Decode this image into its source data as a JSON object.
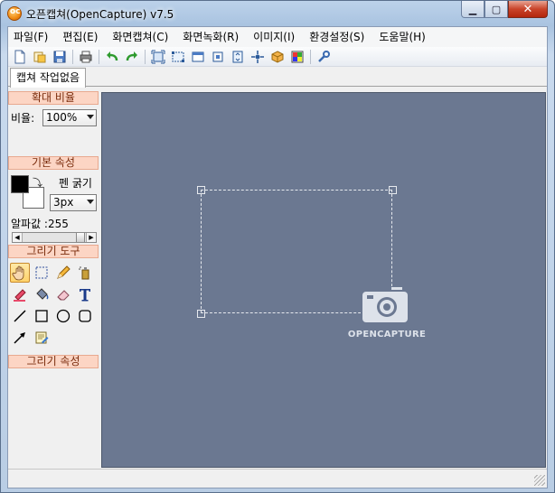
{
  "window": {
    "title": "오픈캡쳐(OpenCapture) v7.5"
  },
  "menu": {
    "items": [
      {
        "label": "파일(F)"
      },
      {
        "label": "편집(E)"
      },
      {
        "label": "화면캡쳐(C)"
      },
      {
        "label": "화면녹화(R)"
      },
      {
        "label": "이미지(I)"
      },
      {
        "label": "환경설정(S)"
      },
      {
        "label": "도움말(H)"
      }
    ]
  },
  "toolbar": {
    "icons": [
      "new-icon",
      "open-icon",
      "save-icon",
      "print-icon",
      "undo-icon",
      "redo-icon",
      "capture-fullscreen-icon",
      "capture-region-icon",
      "capture-window-icon",
      "capture-element-icon",
      "capture-scroll-icon",
      "capture-fixed-icon",
      "capture-3d-icon",
      "color-picker-icon",
      "settings-wrench-icon"
    ]
  },
  "tabs": [
    {
      "label": "캡쳐 작업없음"
    }
  ],
  "panel": {
    "zoom": {
      "header": "확대 비율",
      "label": "비율:",
      "value": "100%"
    },
    "basic": {
      "header": "기본 속성",
      "pen_label": "펜 굵기",
      "pen_value": "3px",
      "alpha_label": "알파값 :255",
      "alpha_value": 255,
      "alpha_max": 255,
      "fg_color": "#000000",
      "bg_color": "#ffffff"
    },
    "draw_tools": {
      "header": "그리기 도구"
    },
    "draw_props": {
      "header": "그리기 속성"
    }
  },
  "canvas": {
    "brand": "OPENCAPTURE",
    "background": "#6b7891"
  },
  "status": {
    "text": ""
  }
}
